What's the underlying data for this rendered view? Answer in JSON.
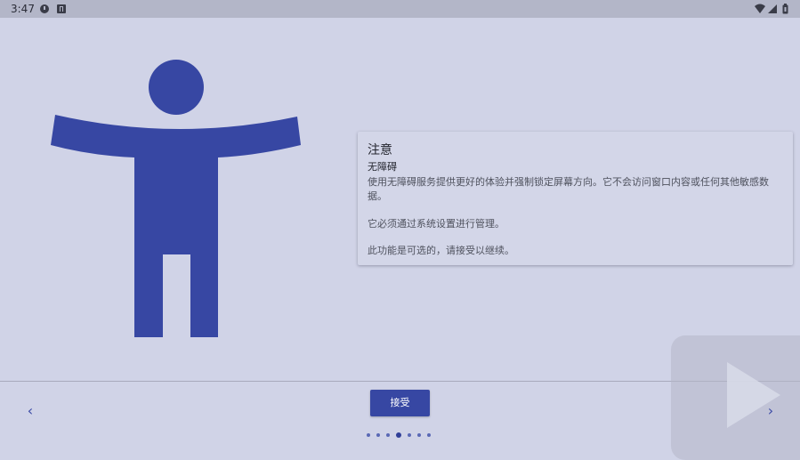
{
  "status_bar": {
    "time": "3:47",
    "icons": [
      "alert-icon",
      "a-icon",
      "wifi-icon",
      "signal-icon",
      "battery-icon"
    ]
  },
  "illustration": {
    "icon": "accessibility-person-icon",
    "color": "#3747a3"
  },
  "notice": {
    "title": "注意",
    "subtitle": "无障碍",
    "body": "使用无障碍服务提供更好的体验并强制锁定屏幕方向。它不会访问窗口内容或任何其他敏感数据。",
    "paragraph2": "它必须通过系统设置进行管理。",
    "paragraph3": "此功能是可选的，请接受以继续。"
  },
  "navigation": {
    "prev_symbol": "‹",
    "next_symbol": "›",
    "accept_label": "接受",
    "page_count": 7,
    "active_page": 4
  },
  "colors": {
    "background": "#d0d3e7",
    "accent": "#3747a3",
    "status_bar": "#b3b6c8"
  }
}
